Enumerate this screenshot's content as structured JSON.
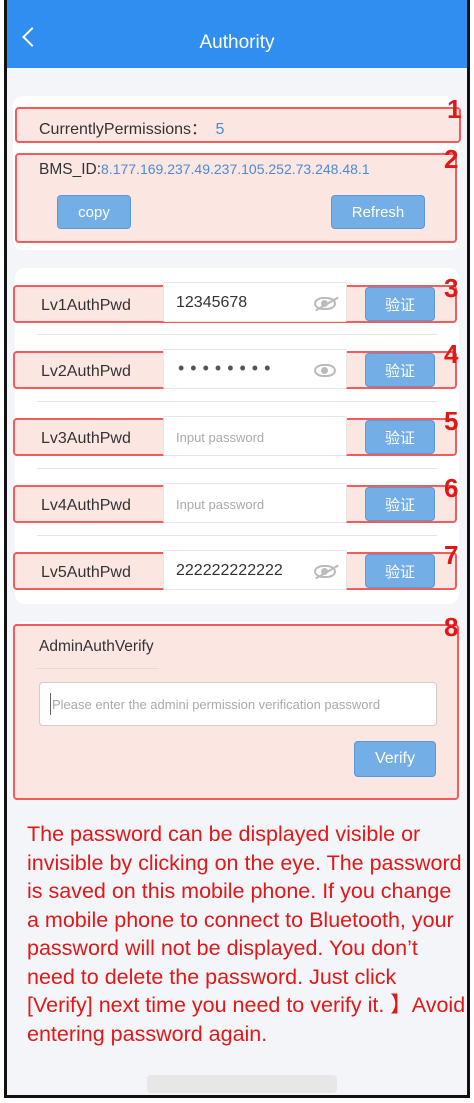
{
  "header": {
    "title": "Authority"
  },
  "permissions": {
    "label": "CurrentlyPermissions：",
    "value": "5"
  },
  "bms": {
    "label": "BMS_ID:",
    "value": "8.177.169.237.49.237.105.252.73.248.48.1"
  },
  "buttons": {
    "copy": "copy",
    "refresh": "Refresh",
    "verify_cn": "验证",
    "verify": "Verify"
  },
  "passwords": [
    {
      "label": "Lv1AuthPwd",
      "value": "12345678",
      "placeholder": ""
    },
    {
      "label": "Lv2AuthPwd",
      "value": "••••••••",
      "placeholder": ""
    },
    {
      "label": "Lv3AuthPwd",
      "value": "",
      "placeholder": "Input password"
    },
    {
      "label": "Lv4AuthPwd",
      "value": "",
      "placeholder": "Input password"
    },
    {
      "label": "Lv5AuthPwd",
      "value": "222222222222",
      "placeholder": ""
    }
  ],
  "admin": {
    "title": "AdminAuthVerify",
    "placeholder": "Please enter the admini permission verification password"
  },
  "markers": [
    "1",
    "2",
    "3",
    "4",
    "5",
    "6",
    "7",
    "8"
  ],
  "note": "The password can be displayed visible or invisible by clicking on the eye. The password is saved on this mobile phone. If you change a mobile phone to connect to Bluetooth, your password will not be displayed. You don’t need to delete the password. Just click [Verify] next time you need to verify it. 】Avoid entering password again.",
  "colors": {
    "header": "#2f8ef0",
    "button": "#74aee6",
    "highlight": "#f25c5c",
    "annotation": "#e01818"
  }
}
